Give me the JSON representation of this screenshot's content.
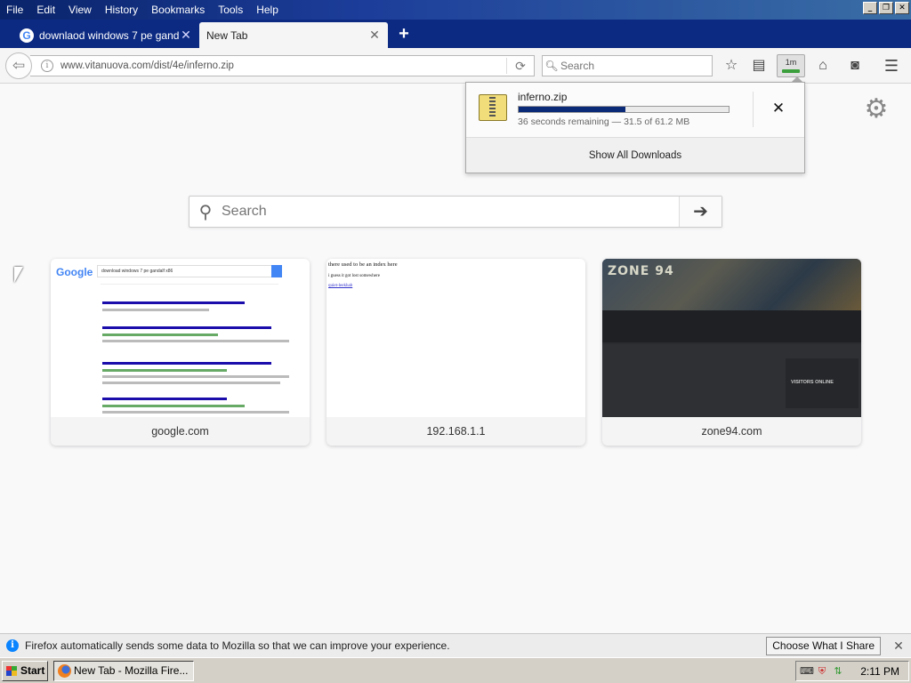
{
  "menu": {
    "items": [
      "File",
      "Edit",
      "View",
      "History",
      "Bookmarks",
      "Tools",
      "Help"
    ]
  },
  "tabs": {
    "inactive_title": "downlaod windows 7 pe gand...",
    "active_title": "New Tab",
    "close_glyph": "✕",
    "new_tab_glyph": "+"
  },
  "toolbar": {
    "url": "www.vitanuova.com/dist/4e/inferno.zip",
    "search_placeholder": "Search",
    "downloads_badge": "1m"
  },
  "downloads": {
    "file_name": "inferno.zip",
    "progress_fraction": 0.51,
    "status": "36 seconds remaining — 31.5 of 61.2 MB",
    "show_all_label": "Show All Downloads"
  },
  "content": {
    "search_placeholder": "Search",
    "tiles": [
      {
        "label": "google.com"
      },
      {
        "label": "192.168.1.1"
      },
      {
        "label": "zone94.com"
      }
    ],
    "google_thumb": {
      "logo": "Google",
      "query": "download windows 7 pe gandalf x86"
    },
    "router_thumb": {
      "line1": "there used to be an index here",
      "line2": "i guess it got lost somewhere",
      "line3": "quiet-leekhab"
    },
    "zone_thumb": {
      "logo": "ZONE 94",
      "visitors": "VISITORS ONLINE"
    }
  },
  "notification": {
    "text": "Firefox automatically sends some data to Mozilla so that we can improve your experience.",
    "button_label": "Choose What I Share"
  },
  "taskbar": {
    "start_label": "Start",
    "task_label": "New Tab - Mozilla Fire...",
    "time": "2:11 PM"
  },
  "colors": {
    "titlebar": "#0a246a",
    "tabstrip": "#0c2a82",
    "progress": "#0a2a78",
    "notif_icon": "#0a84ff"
  }
}
